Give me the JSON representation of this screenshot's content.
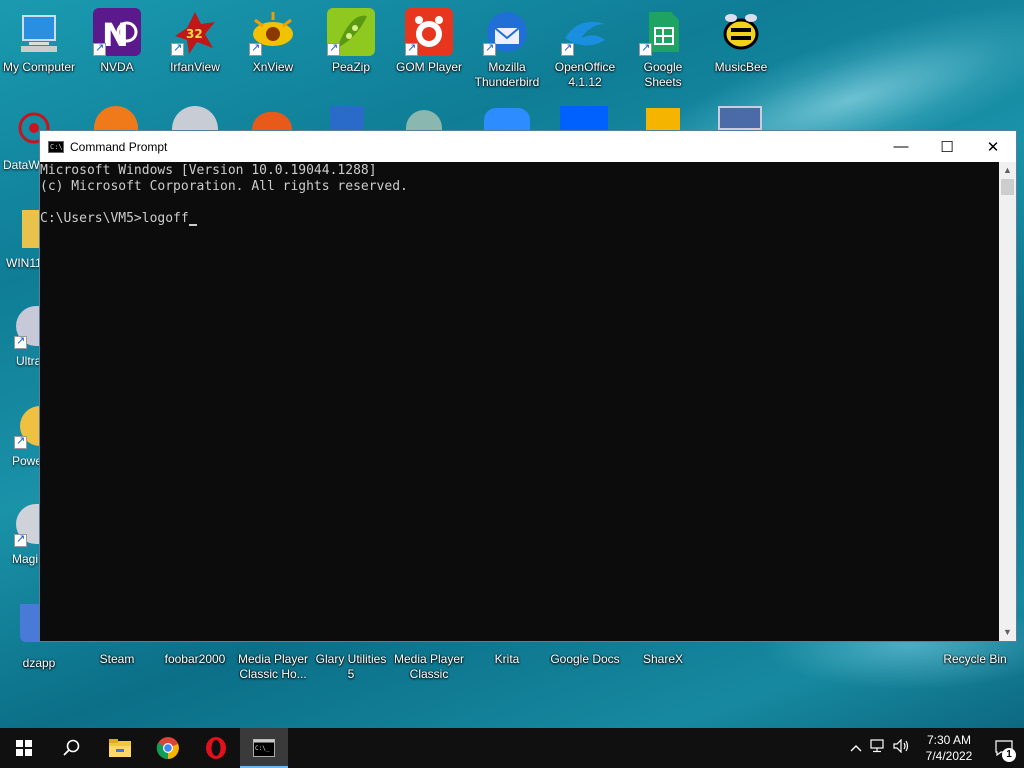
{
  "desktop": {
    "top_row": [
      {
        "label": "My Computer",
        "icon": "computer-icon"
      },
      {
        "label": "NVDA",
        "icon": "nvda-icon"
      },
      {
        "label": "IrfanView",
        "icon": "irfanview-icon"
      },
      {
        "label": "XnView",
        "icon": "xnview-icon"
      },
      {
        "label": "PeaZip",
        "icon": "peazip-icon"
      },
      {
        "label": "GOM Player",
        "icon": "gom-player-icon"
      },
      {
        "label": "Mozilla Thunderbird",
        "icon": "thunderbird-icon"
      },
      {
        "label": "OpenOffice 4.1.12",
        "icon": "openoffice-icon"
      },
      {
        "label": "Google Sheets",
        "icon": "google-sheets-icon"
      },
      {
        "label": "MusicBee",
        "icon": "musicbee-icon"
      }
    ],
    "left_partials": [
      {
        "label": "DataW"
      },
      {
        "label": "WIN11"
      },
      {
        "label": "Ultra"
      },
      {
        "label": "Powe"
      },
      {
        "label": "Magi"
      }
    ],
    "bottom_row": [
      {
        "label": "dzapp"
      },
      {
        "label": "Steam"
      },
      {
        "label": "foobar2000"
      },
      {
        "label": "Media Player Classic Ho..."
      },
      {
        "label": "Glary Utilities 5"
      },
      {
        "label": "Media Player Classic"
      },
      {
        "label": "Krita"
      },
      {
        "label": "Google Docs"
      },
      {
        "label": "ShareX"
      },
      {
        "label": "Recycle Bin"
      }
    ]
  },
  "window": {
    "title": "Command Prompt",
    "minimize": "—",
    "maximize": "☐",
    "close": "✕",
    "console_lines": [
      "Microsoft Windows [Version 10.0.19044.1288]",
      "(c) Microsoft Corporation. All rights reserved.",
      "",
      "C:\\Users\\VM5>logoff"
    ]
  },
  "taskbar": {
    "time": "7:30 AM",
    "date": "7/4/2022",
    "notification_count": "1"
  }
}
